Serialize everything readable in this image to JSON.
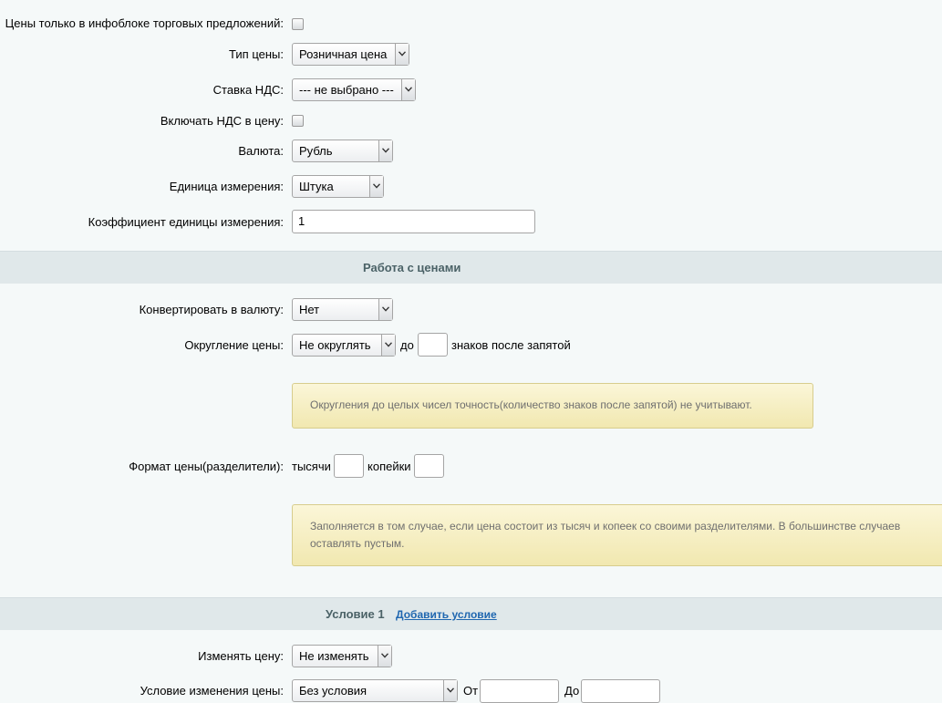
{
  "fields": {
    "offers_only": {
      "label": "Цены только в инфоблоке торговых предложений:"
    },
    "price_type": {
      "label": "Тип цены:",
      "value": "Розничная цена"
    },
    "vat_rate": {
      "label": "Ставка НДС:",
      "value": "--- не выбрано ---"
    },
    "vat_included": {
      "label": "Включать НДС в цену:"
    },
    "currency": {
      "label": "Валюта:",
      "value": "Рубль"
    },
    "unit": {
      "label": "Единица измерения:",
      "value": "Штука"
    },
    "unit_ratio": {
      "label": "Коэффициент единицы измерения:",
      "value": "1"
    }
  },
  "price_section": {
    "title": "Работа с ценами",
    "convert": {
      "label": "Конвертировать в валюту:",
      "value": "Нет"
    },
    "rounding": {
      "label": "Округление цены:",
      "value": "Не округлять",
      "to_label": "до",
      "digits_value": "",
      "suffix": "знаков после запятой"
    },
    "rounding_hint": "Округления до целых чисел точность(количество знаков после запятой) не учитывают.",
    "format": {
      "label": "Формат цены(разделители):",
      "thousands_label": "тысячи",
      "thousands_value": "",
      "kopecks_label": "копейки",
      "kopecks_value": ""
    },
    "format_hint_line1": "Заполняется в том случае, если цена состоит из тысяч и копеек со своими разделителями. В большинстве случаев",
    "format_hint_line2": "оставлять пустым."
  },
  "condition_section": {
    "title": "Условие 1",
    "add_link": "Добавить условие",
    "change_price": {
      "label": "Изменять цену:",
      "value": "Не изменять"
    },
    "condition": {
      "label": "Условие изменения цены:",
      "value": "Без условия",
      "from_label": "От",
      "to_label": "До"
    }
  },
  "icons": {
    "dropdown": "chevron-down-icon"
  }
}
